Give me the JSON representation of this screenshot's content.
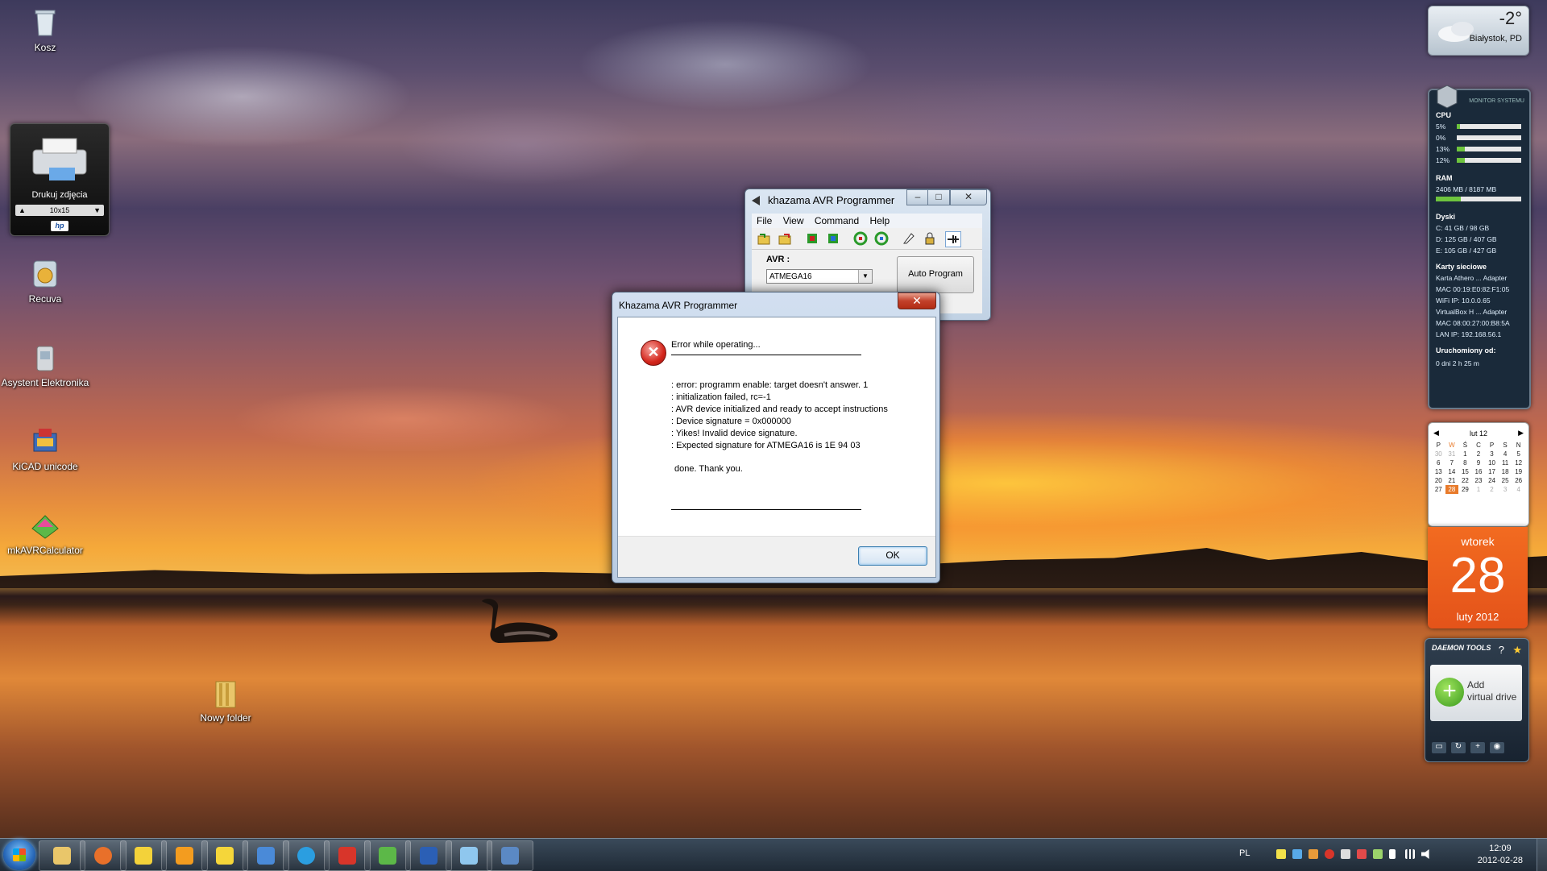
{
  "desktop": {
    "icons": [
      {
        "label": "Kosz",
        "icon": "recycle-bin-icon"
      },
      {
        "label": "Recuva",
        "icon": "recuva-icon"
      },
      {
        "label": "Asystent Elektronika",
        "icon": "asystent-icon"
      },
      {
        "label": "KiCAD unicode",
        "icon": "kicad-icon"
      },
      {
        "label": "mkAVRCalculator",
        "icon": "avr-calculator-icon"
      },
      {
        "label": "Nowy folder",
        "icon": "folder-icon"
      }
    ],
    "hp_gadget": {
      "title": "Drukuj zdjęcia",
      "size": "10x15",
      "brand": "hp"
    }
  },
  "gadgets": {
    "weather": {
      "temp": "-2°",
      "city": "Białystok, PD"
    },
    "monitor": {
      "header": "MONITOR SYSTEMU",
      "cpu_label": "CPU",
      "cpu": [
        {
          "label": "5%",
          "value": 5
        },
        {
          "label": "0%",
          "value": 0
        },
        {
          "label": "13%",
          "value": 13
        },
        {
          "label": "12%",
          "value": 12
        }
      ],
      "ram_label": "RAM",
      "ram_text": "2406 MB / 8187 MB",
      "ram_value": 29,
      "disks_label": "Dyski",
      "disks": [
        "C:   41 GB  /   98 GB",
        "D:  125 GB  /  407 GB",
        "E:  105 GB  /  427 GB"
      ],
      "net_label": "Karty sieciowe",
      "net": [
        "Karta Athero ...  Adapter",
        "MAC  00:19:E0:82:F1:05",
        "WiFi IP:   10.0.0.65",
        "VirtualBox H ...  Adapter",
        "MAC  08:00:27:00:B8:5A",
        "LAN IP:   192.168.56.1"
      ],
      "uptime_label": "Uruchomiony od:",
      "uptime": "0 dni 2 h 25 m"
    },
    "calendar": {
      "month": "lut 12",
      "weekdays": [
        "P",
        "W",
        "Ś",
        "C",
        "P",
        "S",
        "N"
      ],
      "weeks": [
        [
          "30",
          "31",
          "1",
          "2",
          "3",
          "4",
          "5"
        ],
        [
          "6",
          "7",
          "8",
          "9",
          "10",
          "11",
          "12"
        ],
        [
          "13",
          "14",
          "15",
          "16",
          "17",
          "18",
          "19"
        ],
        [
          "20",
          "21",
          "22",
          "23",
          "24",
          "25",
          "26"
        ],
        [
          "27",
          "28",
          "29",
          "1",
          "2",
          "3",
          "4"
        ]
      ],
      "today": "28"
    },
    "date": {
      "weekday": "wtorek",
      "day": "28",
      "month_year": "luty 2012"
    },
    "daemon": {
      "brand": "DAEMON TOOLS",
      "add_line1": "Add",
      "add_line2": "virtual drive"
    }
  },
  "back_window": {
    "title": "khazama AVR Programmer",
    "menu": [
      "File",
      "View",
      "Command",
      "Help"
    ],
    "avr_label": "AVR :",
    "device": "ATMEGA16",
    "auto_program": "Auto Program"
  },
  "dialog": {
    "title": "Khazama AVR Programmer",
    "close": "✕",
    "heading": "Error while operating...",
    "lines": [
      ": error: programm enable: target doesn't answer. 1",
      ": initialization failed, rc=-1",
      ": AVR device initialized and ready to accept instructions",
      ": Device signature = 0x000000",
      ": Yikes!  Invalid device signature.",
      ": Expected signature for ATMEGA16 is 1E 94 03"
    ],
    "done": "done.  Thank you.",
    "ok": "OK"
  },
  "taskbar": {
    "apps": [
      "explorer-icon",
      "firefox-icon",
      "aimp-icon",
      "vlc-icon",
      "sun-app-icon",
      "font-app-icon",
      "skype-icon",
      "red-arrow-icon",
      "avr-calculator-icon",
      "word-icon",
      "virtualbox-icon",
      "remote-desktop-icon"
    ],
    "lang": "PL",
    "time": "12:09",
    "date": "2012-02-28"
  },
  "colors": {
    "accent_orange": "#e4531a",
    "error_red": "#d4261c",
    "taskbar": "#1f2a36"
  }
}
